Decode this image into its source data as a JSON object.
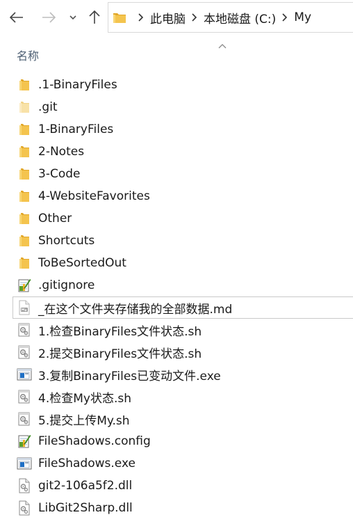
{
  "toolbar": {
    "back_icon": "arrow-left-icon",
    "forward_icon": "arrow-right-icon",
    "recent_icon": "chevron-down-icon",
    "up_icon": "arrow-up-icon"
  },
  "address": {
    "folder_icon": "folder-icon",
    "crumbs": [
      "此电脑",
      "本地磁盘 (C:)",
      "My"
    ]
  },
  "column_header": {
    "name_label": "名称",
    "sort": "ascending"
  },
  "files": [
    {
      "name": ".1-BinaryFiles",
      "icon": "folder-icon"
    },
    {
      "name": ".git",
      "icon": "folder-icon"
    },
    {
      "name": "1-BinaryFiles",
      "icon": "folder-icon"
    },
    {
      "name": "2-Notes",
      "icon": "folder-icon"
    },
    {
      "name": "3-Code",
      "icon": "folder-icon"
    },
    {
      "name": "4-WebsiteFavorites",
      "icon": "folder-icon"
    },
    {
      "name": "Other",
      "icon": "folder-icon"
    },
    {
      "name": "Shortcuts",
      "icon": "folder-icon"
    },
    {
      "name": "ToBeSortedOut",
      "icon": "folder-icon"
    },
    {
      "name": ".gitignore",
      "icon": "text-file-icon"
    },
    {
      "name": "_在这个文件夹存储我的全部数据.md",
      "icon": "markdown-file-icon"
    },
    {
      "name": "1.检查BinaryFiles文件状态.sh",
      "icon": "script-file-icon"
    },
    {
      "name": "2.提交BinaryFiles文件状态.sh",
      "icon": "script-file-icon"
    },
    {
      "name": "3.复制BinaryFiles已变动文件.exe",
      "icon": "exe-file-icon"
    },
    {
      "name": "4.检查My状态.sh",
      "icon": "script-file-icon"
    },
    {
      "name": "5.提交上传My.sh",
      "icon": "script-file-icon"
    },
    {
      "name": "FileShadows.config",
      "icon": "text-file-icon"
    },
    {
      "name": "FileShadows.exe",
      "icon": "exe-file-icon"
    },
    {
      "name": "git2-106a5f2.dll",
      "icon": "dll-file-icon"
    },
    {
      "name": "LibGit2Sharp.dll",
      "icon": "dll-file-icon"
    }
  ],
  "selected_index": 10,
  "colors": {
    "folder": "#f4c44e",
    "folder_dark": "#e2a82a",
    "hidden_folder": "#f8e2a8",
    "header_text": "#4d5f73",
    "selection_border": "#c9c9c9"
  }
}
